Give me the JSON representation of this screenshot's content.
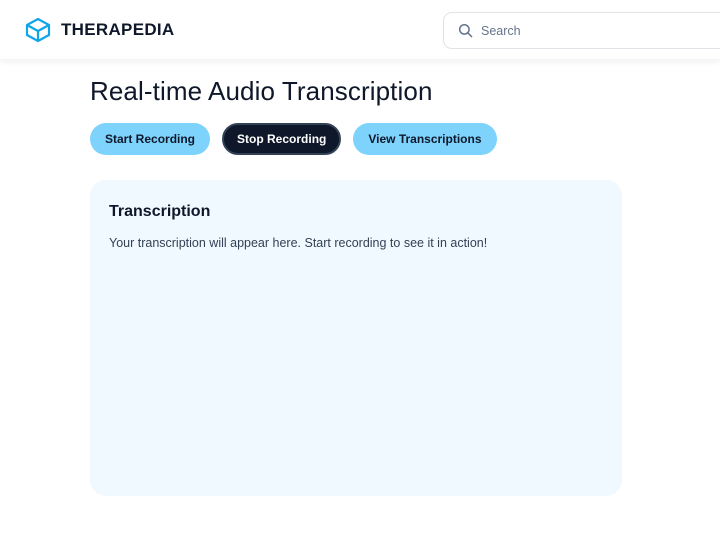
{
  "header": {
    "brand_name": "THERAPEDIA",
    "logo_icon": "hexagon-cube-icon",
    "search": {
      "icon": "search-icon",
      "placeholder": "Search",
      "value": ""
    }
  },
  "main": {
    "title": "Real-time Audio Transcription",
    "buttons": {
      "start_label": "Start Recording",
      "stop_label": "Stop Recording",
      "view_label": "View Transcriptions"
    },
    "transcription": {
      "heading": "Transcription",
      "body": "Your transcription will appear here. Start recording to see it in action!"
    }
  },
  "colors": {
    "brand_accent": "#0ea5e9",
    "button_light": "#7dd3fc",
    "button_dark": "#0f172a",
    "card_background": "#f0f9ff",
    "text_primary": "#0f172a"
  }
}
